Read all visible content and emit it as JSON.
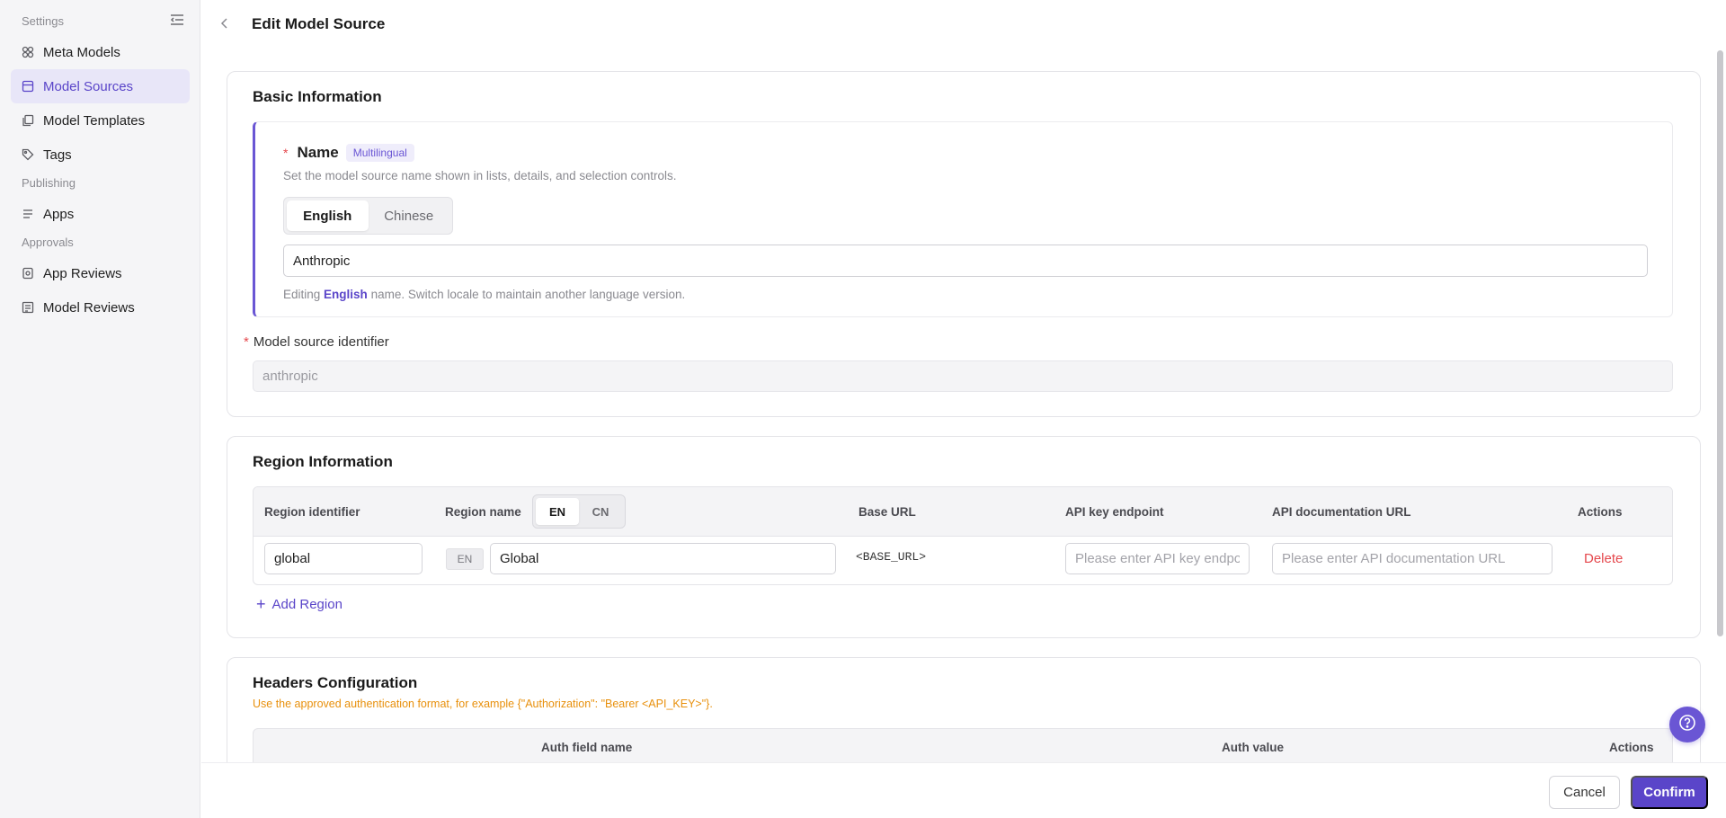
{
  "sidebar": {
    "sections": {
      "settings": "Settings",
      "publishing": "Publishing",
      "approvals": "Approvals"
    },
    "items": {
      "meta_models": "Meta Models",
      "model_sources": "Model Sources",
      "model_templates": "Model Templates",
      "tags": "Tags",
      "apps": "Apps",
      "app_reviews": "App Reviews",
      "model_reviews": "Model Reviews"
    },
    "active_item": "model_sources"
  },
  "header": {
    "title": "Edit Model Source"
  },
  "basic_info": {
    "title": "Basic Information",
    "name": {
      "required_mark": "*",
      "label": "Name",
      "badge": "Multilingual",
      "help": "Set the model source name shown in lists, details, and selection controls.",
      "locales": [
        "English",
        "Chinese"
      ],
      "active_locale": "English",
      "value": "Anthropic",
      "edit_note_prefix": "Editing",
      "edit_note_locale": "English",
      "edit_note_suffix": "name. Switch locale to maintain another language version."
    },
    "identifier": {
      "required_mark": "*",
      "label": "Model source identifier",
      "value": "anthropic"
    }
  },
  "region_info": {
    "title": "Region Information",
    "columns": {
      "identifier": "Region identifier",
      "name": "Region name",
      "base_url": "Base URL",
      "api_key_endpoint": "API key endpoint",
      "api_doc_url": "API documentation URL",
      "actions": "Actions"
    },
    "name_locales": [
      "EN",
      "CN"
    ],
    "active_name_locale": "EN",
    "rows": [
      {
        "identifier": "global",
        "locale_tag": "EN",
        "name": "Global",
        "base_url": "<BASE_URL>",
        "api_key_endpoint_placeholder": "Please enter API key endpoint",
        "api_doc_url_placeholder": "Please enter API documentation URL",
        "delete_label": "Delete"
      }
    ],
    "add_label": "Add Region"
  },
  "headers_config": {
    "title": "Headers Configuration",
    "note": "Use the approved authentication format, for example {\"Authorization\": \"Bearer <API_KEY>\"}.",
    "columns": {
      "field_name": "Auth field name",
      "value": "Auth value",
      "actions": "Actions"
    }
  },
  "footer": {
    "cancel": "Cancel",
    "confirm": "Confirm"
  },
  "colors": {
    "accent": "#5a45c9",
    "danger": "#e5484d",
    "warning": "#e8900c"
  }
}
